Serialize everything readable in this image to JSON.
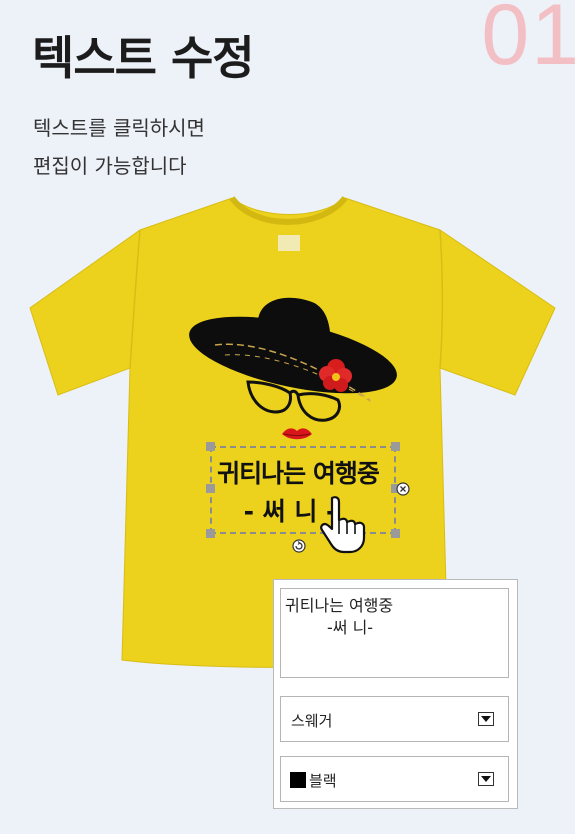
{
  "step_number": "01",
  "title": "텍스트 수정",
  "description": [
    "텍스트를 클릭하시면",
    "편집이 가능합니다"
  ],
  "design": {
    "line1": "귀티나는 여행중",
    "line2": "- 써 니 -"
  },
  "editor": {
    "text_value_line1": "귀티나는 여행중",
    "text_value_line2": "-써 니-",
    "font_select": "스웨거",
    "color_select": "블랙"
  },
  "colors": {
    "background": "#edf1f8",
    "shirt": "#ecd21c",
    "step_number": "#f2bfc4"
  }
}
